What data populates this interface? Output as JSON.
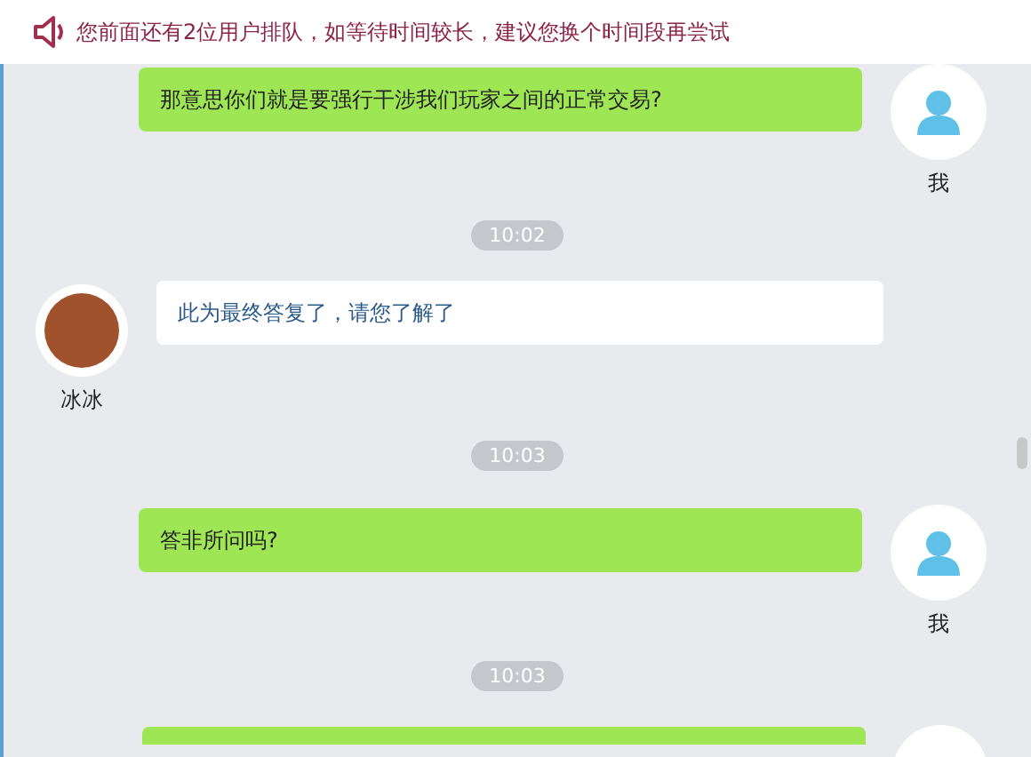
{
  "notice": {
    "text": "您前面还有2位用户排队，如等待时间较长，建议您换个时间段再尝试"
  },
  "messages": [
    {
      "kind": "outgoing",
      "text": "那意思你们就是要强行干涉我们玩家之间的正常交易?",
      "sender": "我"
    },
    {
      "kind": "time",
      "text": "10:02"
    },
    {
      "kind": "incoming",
      "text": "此为最终答复了，请您了解了",
      "sender": "冰冰"
    },
    {
      "kind": "time",
      "text": "10:03"
    },
    {
      "kind": "outgoing",
      "text": "答非所问吗?",
      "sender": "我"
    },
    {
      "kind": "time",
      "text": "10:03"
    },
    {
      "kind": "partial"
    }
  ]
}
